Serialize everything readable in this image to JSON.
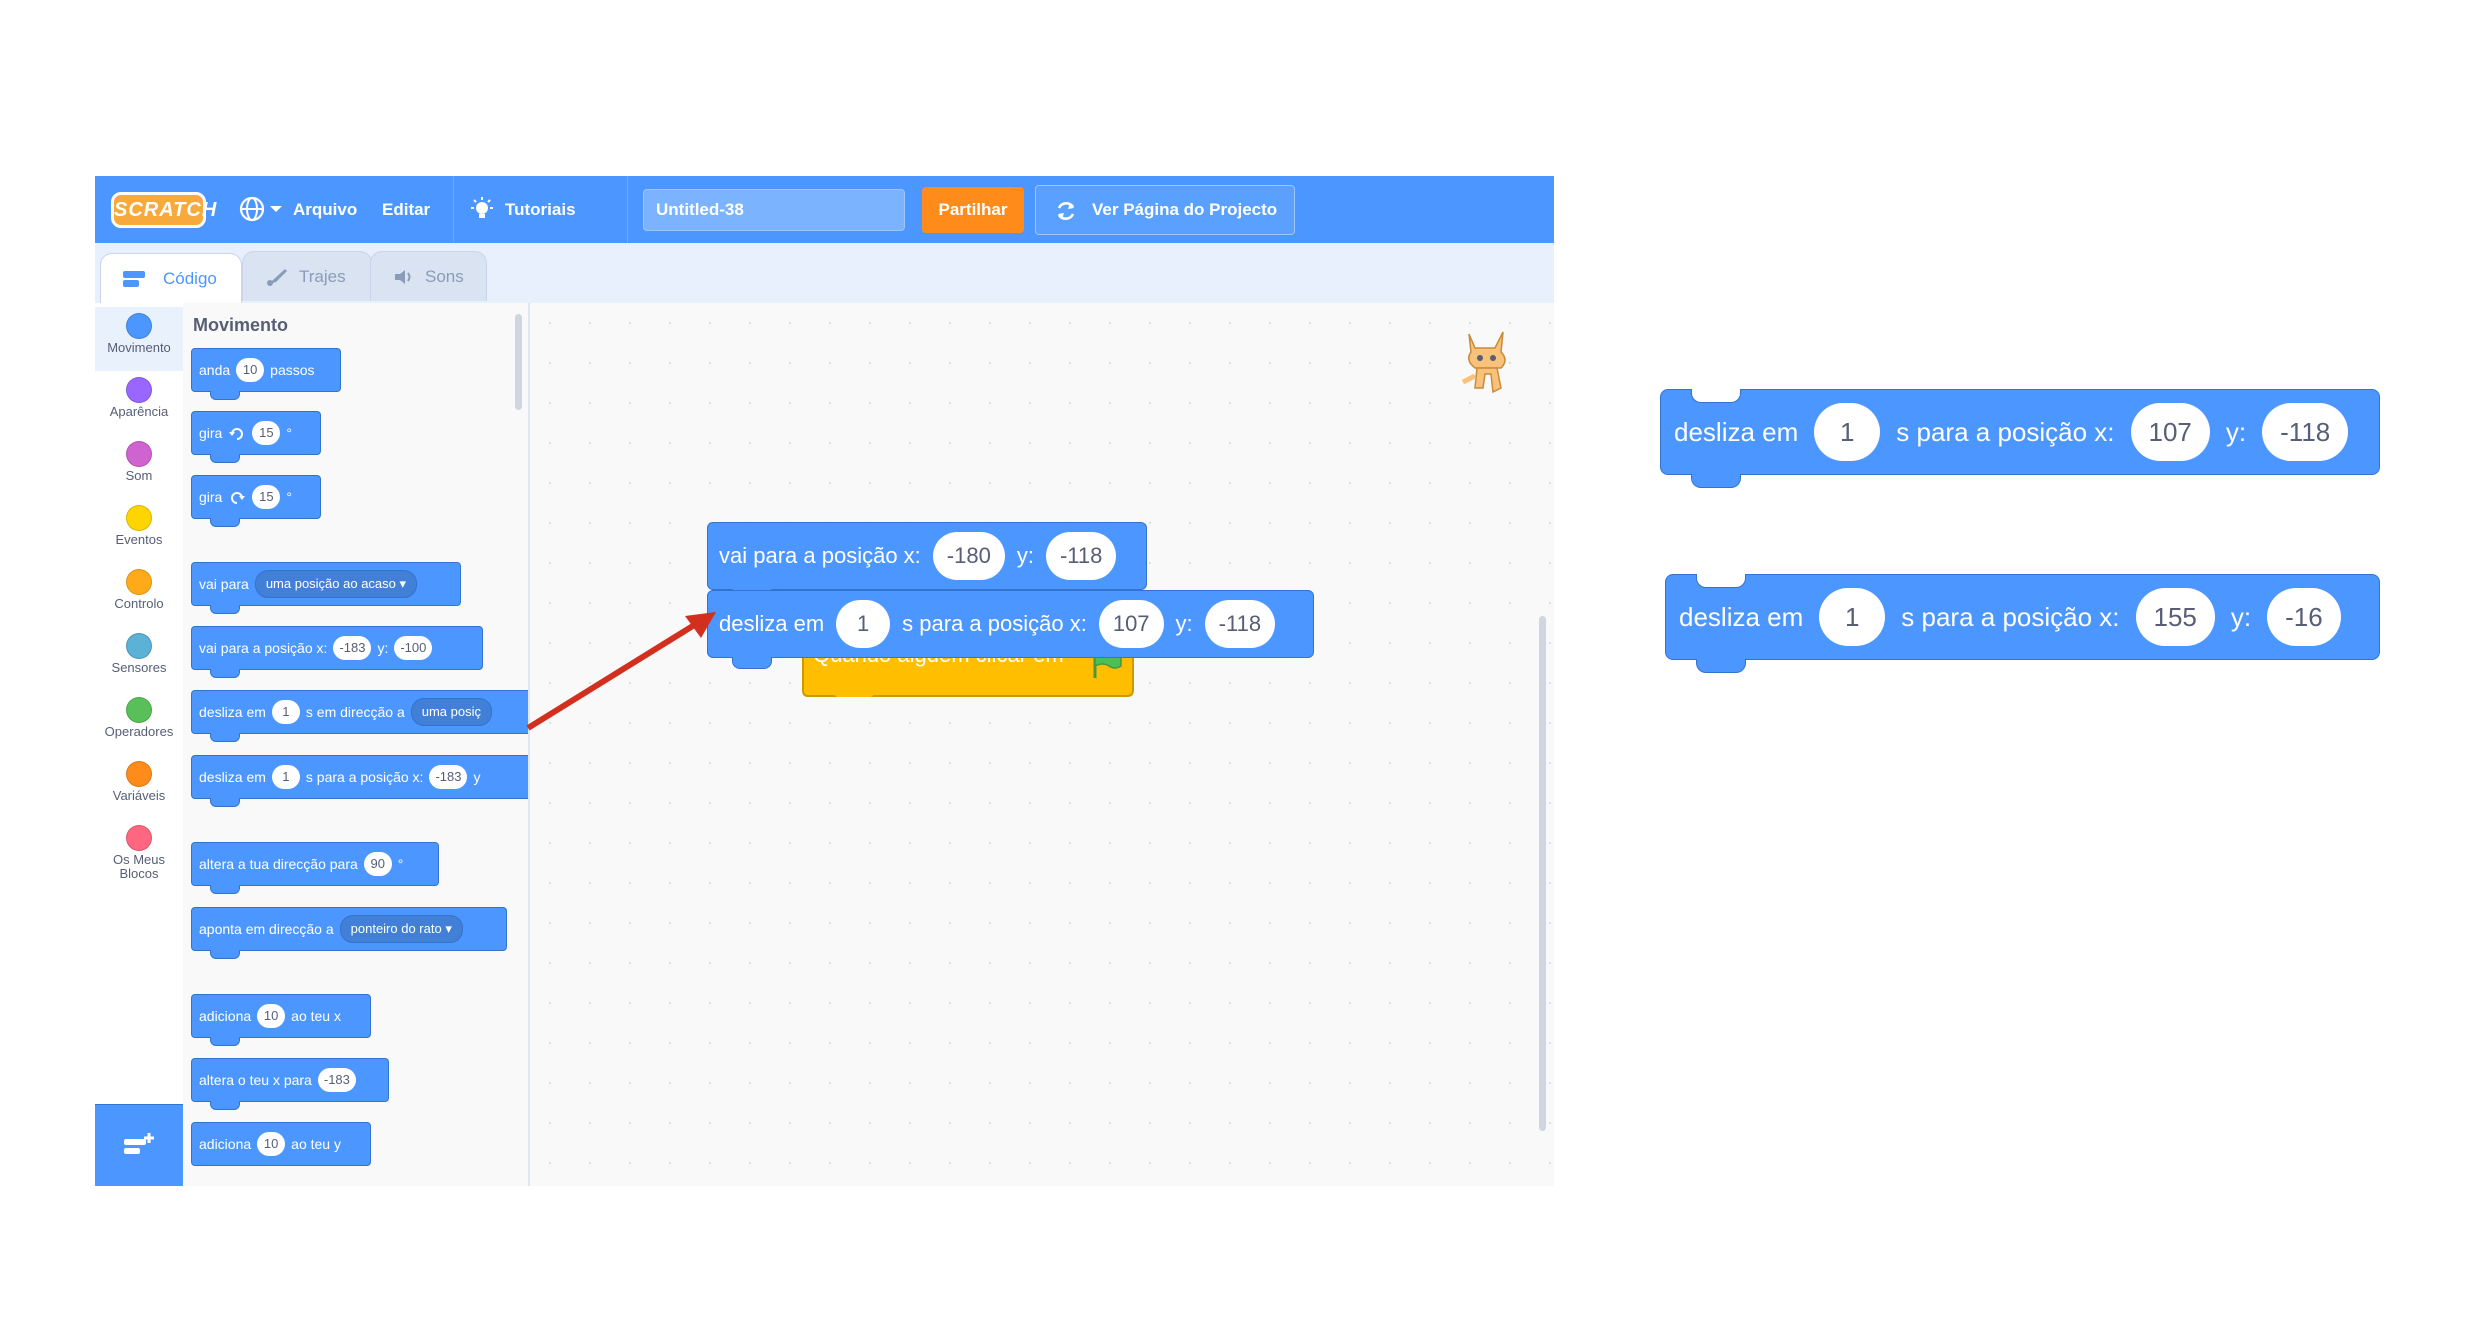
{
  "menubar": {
    "logo": "SCRATCH",
    "file": "Arquivo",
    "edit": "Editar",
    "tutorials": "Tutoriais",
    "project_title": "Untitled-38",
    "share": "Partilhar",
    "project_page": "Ver Página do Projecto"
  },
  "tabs": {
    "code": "Código",
    "costumes": "Trajes",
    "sounds": "Sons"
  },
  "categories": [
    {
      "label": "Movimento",
      "color": "#4c97ff"
    },
    {
      "label": "Aparência",
      "color": "#9966ff"
    },
    {
      "label": "Som",
      "color": "#cf63cf"
    },
    {
      "label": "Eventos",
      "color": "#ffd500"
    },
    {
      "label": "Controlo",
      "color": "#ffab19"
    },
    {
      "label": "Sensores",
      "color": "#5cb1d6"
    },
    {
      "label": "Operadores",
      "color": "#59c059"
    },
    {
      "label": "Variáveis",
      "color": "#ff8c1a"
    },
    {
      "label": "Os Meus",
      "label2": "Blocos",
      "color": "#ff6680"
    }
  ],
  "palette": {
    "title": "Movimento",
    "b1": {
      "a": "anda",
      "v": "10",
      "b": "passos"
    },
    "b2": {
      "a": "gira",
      "v": "15",
      "deg": "°"
    },
    "b3": {
      "a": "gira",
      "v": "15",
      "deg": "°"
    },
    "b4": {
      "a": "vai para",
      "dd": "uma posição ao acaso ▾"
    },
    "b5": {
      "a": "vai para a posição x:",
      "x": "-183",
      "y_lbl": "y:",
      "y": "-100"
    },
    "b6": {
      "a": "desliza em",
      "v": "1",
      "b": "s em direcção a",
      "dd": "uma posiç"
    },
    "b7": {
      "a": "desliza em",
      "v": "1",
      "b": "s para a posição x:",
      "x": "-183",
      "y_lbl": "y"
    },
    "b8": {
      "a": "altera a tua direcção para",
      "v": "90",
      "deg": "°"
    },
    "b9": {
      "a": "aponta em direcção a",
      "dd": "ponteiro do rato ▾"
    },
    "b10": {
      "a": "adiciona",
      "v": "10",
      "b": "ao teu x"
    },
    "b11": {
      "a": "altera o teu x para",
      "v": "-183"
    },
    "b12": {
      "a": "adiciona",
      "v": "10",
      "b": "ao teu y"
    }
  },
  "script": {
    "hat": "Quando alguém clicar em",
    "goto": {
      "a": "vai para a posição x:",
      "x": "-180",
      "y_lbl": "y:",
      "y": "-118"
    },
    "glide": {
      "a": "desliza em",
      "v": "1",
      "b": "s para a posição x:",
      "x": "107",
      "y_lbl": "y:",
      "y": "-118"
    }
  },
  "standalone": [
    {
      "a": "desliza em",
      "v": "1",
      "b": "s para a posição x:",
      "x": "107",
      "y_lbl": "y:",
      "y": "-118"
    },
    {
      "a": "desliza em",
      "v": "1",
      "b": "s para a posição x:",
      "x": "155",
      "y_lbl": "y:",
      "y": "-16"
    }
  ],
  "colors": {
    "motion": "#4c97ff",
    "events": "#ffbf00",
    "arrow": "#d32f1e",
    "share": "#ff8c1a"
  }
}
